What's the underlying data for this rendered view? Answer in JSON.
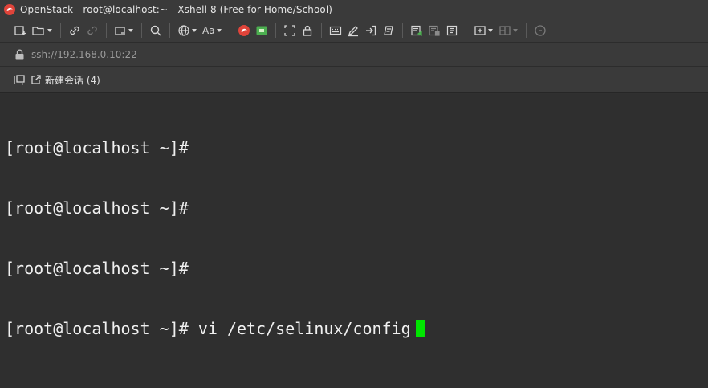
{
  "window": {
    "title": "OpenStack - root@localhost:~ - Xshell 8 (Free for Home/School)"
  },
  "toolbar": {
    "font_label": "Aa"
  },
  "address": {
    "value": "ssh://192.168.0.10:22"
  },
  "session": {
    "label": "新建会话 (4)"
  },
  "terminal": {
    "lines": [
      "[root@localhost ~]#",
      "[root@localhost ~]#",
      "[root@localhost ~]#",
      "[root@localhost ~]# vi /etc/selinux/config"
    ]
  },
  "colors": {
    "cursor": "#00e600",
    "brand_red": "#e0443a",
    "brand_green": "#4caf50"
  }
}
